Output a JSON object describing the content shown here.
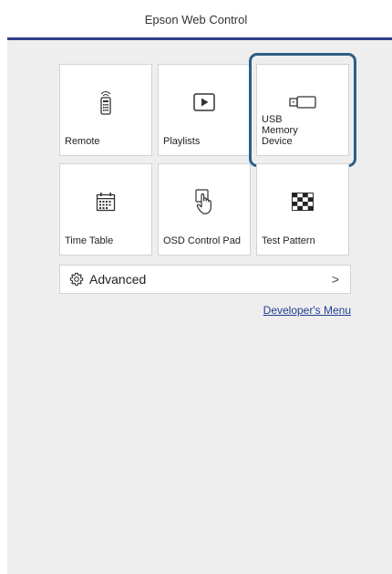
{
  "header": {
    "title": "Epson Web Control"
  },
  "tiles": [
    {
      "label": "Remote",
      "icon": "remote-icon"
    },
    {
      "label": "Playlists",
      "icon": "play-icon"
    },
    {
      "label": "USB Memory Device",
      "icon": "usb-memory-icon",
      "selected": true
    },
    {
      "label": "Time Table",
      "icon": "calendar-icon"
    },
    {
      "label": "OSD Control Pad",
      "icon": "touch-hand-icon"
    },
    {
      "label": "Test Pattern",
      "icon": "checkerboard-icon"
    }
  ],
  "advanced": {
    "label": "Advanced",
    "icon": "gear-icon",
    "chevron": ">"
  },
  "links": {
    "developer_menu": "Developer's Menu"
  },
  "colors": {
    "accent": "#2f3e86",
    "selection": "#2c5f86",
    "link": "#1f3f8f",
    "panel_bg": "#eeeeee"
  }
}
